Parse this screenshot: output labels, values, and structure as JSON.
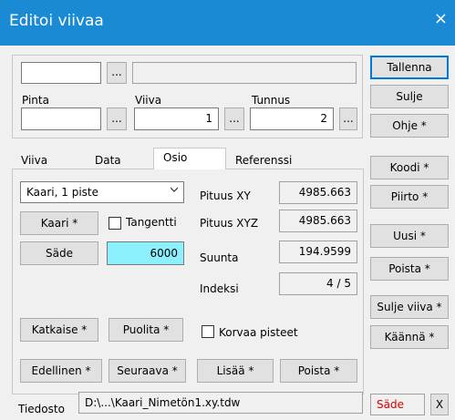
{
  "window": {
    "title": "Editoi viivaa",
    "close_glyph": "×"
  },
  "top": {
    "field1": "",
    "browse": "...",
    "field_wide": "",
    "pinta_label": "Pinta",
    "viiva_label": "Viiva",
    "tunnus_label": "Tunnus",
    "pinta_value": "",
    "viiva_value": "1",
    "tunnus_value": "2"
  },
  "right_buttons": {
    "tallenna": "Tallenna",
    "sulje": "Sulje",
    "ohje": "Ohje *",
    "koodi": "Koodi *",
    "piirto": "Piirto *",
    "uusi": "Uusi *",
    "poista": "Poista *",
    "sulje_viiva": "Sulje viiva *",
    "kaanna": "Käännä *"
  },
  "tabs": [
    "Viiva",
    "Data",
    "Osio",
    "Referenssi"
  ],
  "active_tab": "Osio",
  "osio": {
    "type_select": "Kaari, 1 piste",
    "kaari_button": "Kaari *",
    "tangentti_label": "Tangentti",
    "tangentti_checked": false,
    "sade_button": "Säde",
    "sade_value": "6000",
    "pituus_xy_label": "Pituus XY",
    "pituus_xy_value": "4985.663",
    "pituus_xyz_label": "Pituus XYZ",
    "pituus_xyz_value": "4985.663",
    "suunta_label": "Suunta",
    "suunta_value": "194.9599",
    "indeksi_label": "Indeksi",
    "indeksi_value": "4 / 5",
    "katkaise": "Katkaise *",
    "puolita": "Puolita *",
    "korvaa_label": "Korvaa pisteet",
    "korvaa_checked": false,
    "edellinen": "Edellinen *",
    "seuraava": "Seuraava *",
    "lisaa": "Lisää *",
    "poista": "Poista *"
  },
  "bottom": {
    "tiedosto_label": "Tiedosto",
    "tiedosto_path": "D:\\...\\Kaari_Nimetön1.xy.tdw",
    "sade_status": "Säde",
    "x_button": "X"
  },
  "colors": {
    "titlebar": "#1a8ad4",
    "sade_field": "#8cf0ff",
    "status_red": "#d00000",
    "default_border": "#0078d7"
  }
}
